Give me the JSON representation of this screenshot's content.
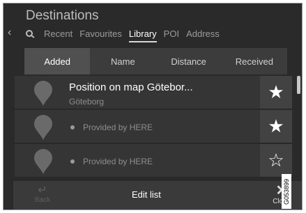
{
  "header": {
    "title": "Destinations"
  },
  "nav": {
    "left_arrow": "‹",
    "right_arrow": "›"
  },
  "tabs": [
    {
      "label": "Recent"
    },
    {
      "label": "Favourites"
    },
    {
      "label": "Library",
      "active": true
    },
    {
      "label": "POI"
    },
    {
      "label": "Address"
    }
  ],
  "sort_tabs": [
    {
      "label": "Added",
      "active": true
    },
    {
      "label": "Name"
    },
    {
      "label": "Distance"
    },
    {
      "label": "Received"
    }
  ],
  "rows": [
    {
      "title": "Position on map Götebor...",
      "subtitle": "Göteborg",
      "favourite": true,
      "star": "★"
    },
    {
      "provider": "Provided by HERE",
      "favourite": true,
      "star": "★"
    },
    {
      "provider": "Provided by HERE",
      "favourite": false,
      "star": "☆"
    }
  ],
  "bottom_bar": {
    "back_label": "Back",
    "back_icon": "↵",
    "edit_label": "Edit list",
    "close_label": "Close",
    "close_icon": "✕"
  },
  "image_code": "G053899",
  "colors": {
    "background": "#2a2a2a",
    "active_text": "#ffffff",
    "inactive_text": "#9c9c9c"
  }
}
